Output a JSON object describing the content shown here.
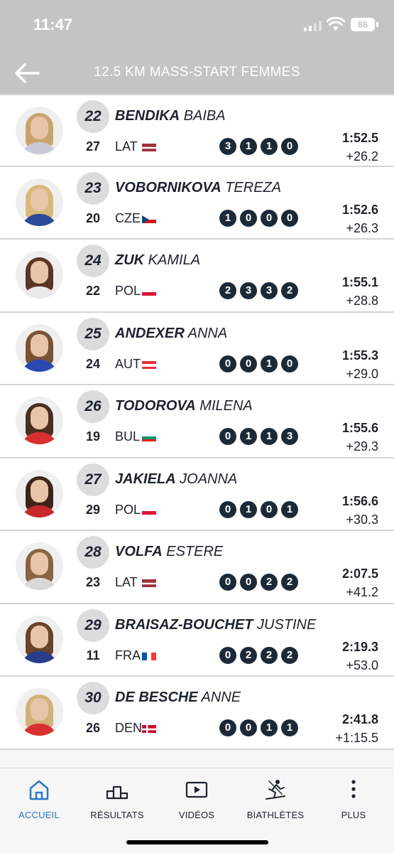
{
  "status_bar": {
    "time": "11:47",
    "battery": "86"
  },
  "header": {
    "title": "12.5 KM MASS-START FEMMES"
  },
  "results": [
    {
      "rank": "22",
      "last": "BENDIKA",
      "first": "BAIBA",
      "bib": "27",
      "nation": "LAT",
      "flag": "LAT",
      "shots": [
        "3",
        "1",
        "1",
        "0"
      ],
      "time": "1:52.5",
      "behind": "+26.2",
      "hair": "#c9a46a",
      "kit": "#c8c8d8"
    },
    {
      "rank": "23",
      "last": "VOBORNIKOVA",
      "first": "TEREZA",
      "bib": "20",
      "nation": "CZE",
      "flag": "CZE",
      "shots": [
        "1",
        "0",
        "0",
        "0"
      ],
      "time": "1:52.6",
      "behind": "+26.3",
      "hair": "#d9b878",
      "kit": "#2a4a9a"
    },
    {
      "rank": "24",
      "last": "ZUK",
      "first": "KAMILA",
      "bib": "22",
      "nation": "POL",
      "flag": "POL",
      "shots": [
        "2",
        "3",
        "3",
        "2"
      ],
      "time": "1:55.1",
      "behind": "+28.8",
      "hair": "#5a3626",
      "kit": "#e8e8e8"
    },
    {
      "rank": "25",
      "last": "ANDEXER",
      "first": "ANNA",
      "bib": "24",
      "nation": "AUT",
      "flag": "AUT",
      "shots": [
        "0",
        "0",
        "1",
        "0"
      ],
      "time": "1:55.3",
      "behind": "+29.0",
      "hair": "#7a5234",
      "kit": "#2a4ab0"
    },
    {
      "rank": "26",
      "last": "TODOROVA",
      "first": "MILENA",
      "bib": "19",
      "nation": "BUL",
      "flag": "BUL",
      "shots": [
        "0",
        "1",
        "1",
        "3"
      ],
      "time": "1:55.6",
      "behind": "+29.3",
      "hair": "#4a2e20",
      "kit": "#d83030"
    },
    {
      "rank": "27",
      "last": "JAKIELA",
      "first": "JOANNA",
      "bib": "29",
      "nation": "POL",
      "flag": "POL",
      "shots": [
        "0",
        "1",
        "0",
        "1"
      ],
      "time": "1:56.6",
      "behind": "+30.3",
      "hair": "#3e2418",
      "kit": "#c82828"
    },
    {
      "rank": "28",
      "last": "VOLFA",
      "first": "ESTERE",
      "bib": "23",
      "nation": "LAT",
      "flag": "LAT",
      "shots": [
        "0",
        "0",
        "2",
        "2"
      ],
      "time": "2:07.5",
      "behind": "+41.2",
      "hair": "#8a6440",
      "kit": "#d8d8d8"
    },
    {
      "rank": "29",
      "last": "BRAISAZ-BOUCHET",
      "first": "JUSTINE",
      "bib": "11",
      "nation": "FRA",
      "flag": "FRA",
      "shots": [
        "0",
        "2",
        "2",
        "2"
      ],
      "time": "2:19.3",
      "behind": "+53.0",
      "hair": "#6a4428",
      "kit": "#2a3c8c"
    },
    {
      "rank": "30",
      "last": "DE BESCHE",
      "first": "ANNE",
      "bib": "26",
      "nation": "DEN",
      "flag": "DEN",
      "shots": [
        "0",
        "0",
        "1",
        "1"
      ],
      "time": "2:41.8",
      "behind": "+1:15.5",
      "hair": "#d2b27a",
      "kit": "#d83030"
    }
  ],
  "tabs": [
    {
      "label": "ACCUEIL",
      "icon": "home-icon",
      "active": true
    },
    {
      "label": "RÉSULTATS",
      "icon": "podium-icon",
      "active": false
    },
    {
      "label": "VIDÉOS",
      "icon": "video-icon",
      "active": false
    },
    {
      "label": "BIATHLÈTES",
      "icon": "biathlete-icon",
      "active": false
    },
    {
      "label": "PLUS",
      "icon": "more-icon",
      "active": false
    }
  ],
  "colors": {
    "accent": "#2a77c8",
    "header": "#c4c4c4",
    "shot": "#1c2a38",
    "text": "#1c2230"
  }
}
